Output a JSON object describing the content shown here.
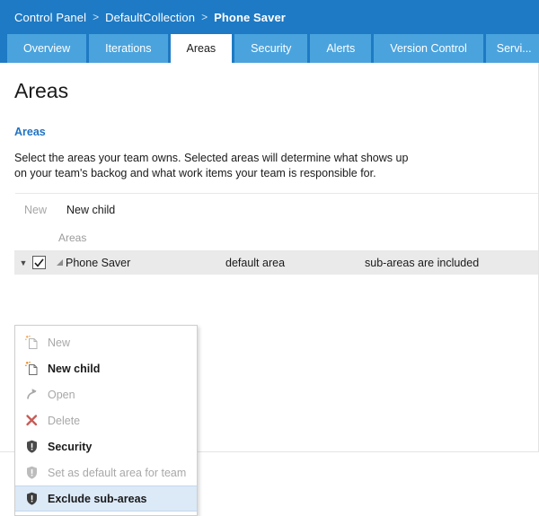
{
  "header": {
    "breadcrumb": [
      {
        "label": "Control Panel",
        "current": false
      },
      {
        "label": "DefaultCollection",
        "current": false
      },
      {
        "label": "Phone Saver",
        "current": true
      }
    ],
    "separator": ">",
    "background": "#1e7ac4"
  },
  "tabs": [
    {
      "label": "Overview",
      "active": false
    },
    {
      "label": "Iterations",
      "active": false
    },
    {
      "label": "Areas",
      "active": true
    },
    {
      "label": "Security",
      "active": false
    },
    {
      "label": "Alerts",
      "active": false
    },
    {
      "label": "Version Control",
      "active": false
    },
    {
      "label": "Servi...",
      "active": false
    }
  ],
  "page": {
    "title": "Areas",
    "section_title": "Areas",
    "description": "Select the areas your team owns. Selected areas will determine what shows up on your team's backog and what work items your team is responsible for."
  },
  "toolbar": {
    "new_label": "New",
    "new_child_label": "New child"
  },
  "grid": {
    "columns": [
      "Areas",
      "",
      ""
    ],
    "rows": [
      {
        "name": "Phone Saver",
        "default": "default area",
        "sub": "sub-areas are included",
        "checked": true,
        "expanded": true
      }
    ]
  },
  "context_menu": {
    "items": [
      {
        "label": "New",
        "icon": "new-page-icon",
        "disabled": true,
        "bold": false,
        "highlight": false
      },
      {
        "label": "New child",
        "icon": "new-child-page-icon",
        "disabled": false,
        "bold": true,
        "highlight": false
      },
      {
        "label": "Open",
        "icon": "open-arrow-icon",
        "disabled": true,
        "bold": false,
        "highlight": false
      },
      {
        "label": "Delete",
        "icon": "delete-x-icon",
        "disabled": true,
        "bold": false,
        "highlight": false
      },
      {
        "label": "Security",
        "icon": "shield-icon",
        "disabled": false,
        "bold": true,
        "highlight": false
      },
      {
        "label": "Set as default area for team",
        "icon": "shield-icon",
        "disabled": true,
        "bold": false,
        "highlight": false
      },
      {
        "label": "Exclude sub-areas",
        "icon": "shield-icon",
        "disabled": false,
        "bold": true,
        "highlight": true
      }
    ],
    "highlight_color": "#dce9f7"
  },
  "colors": {
    "brand_blue": "#1e7ac4",
    "tab_blue": "#4aa3dd",
    "link_blue": "#1f72c4",
    "row_gray": "#eaeaea",
    "delete_red": "#c75b56",
    "sparkle_orange": "#e8871a"
  }
}
